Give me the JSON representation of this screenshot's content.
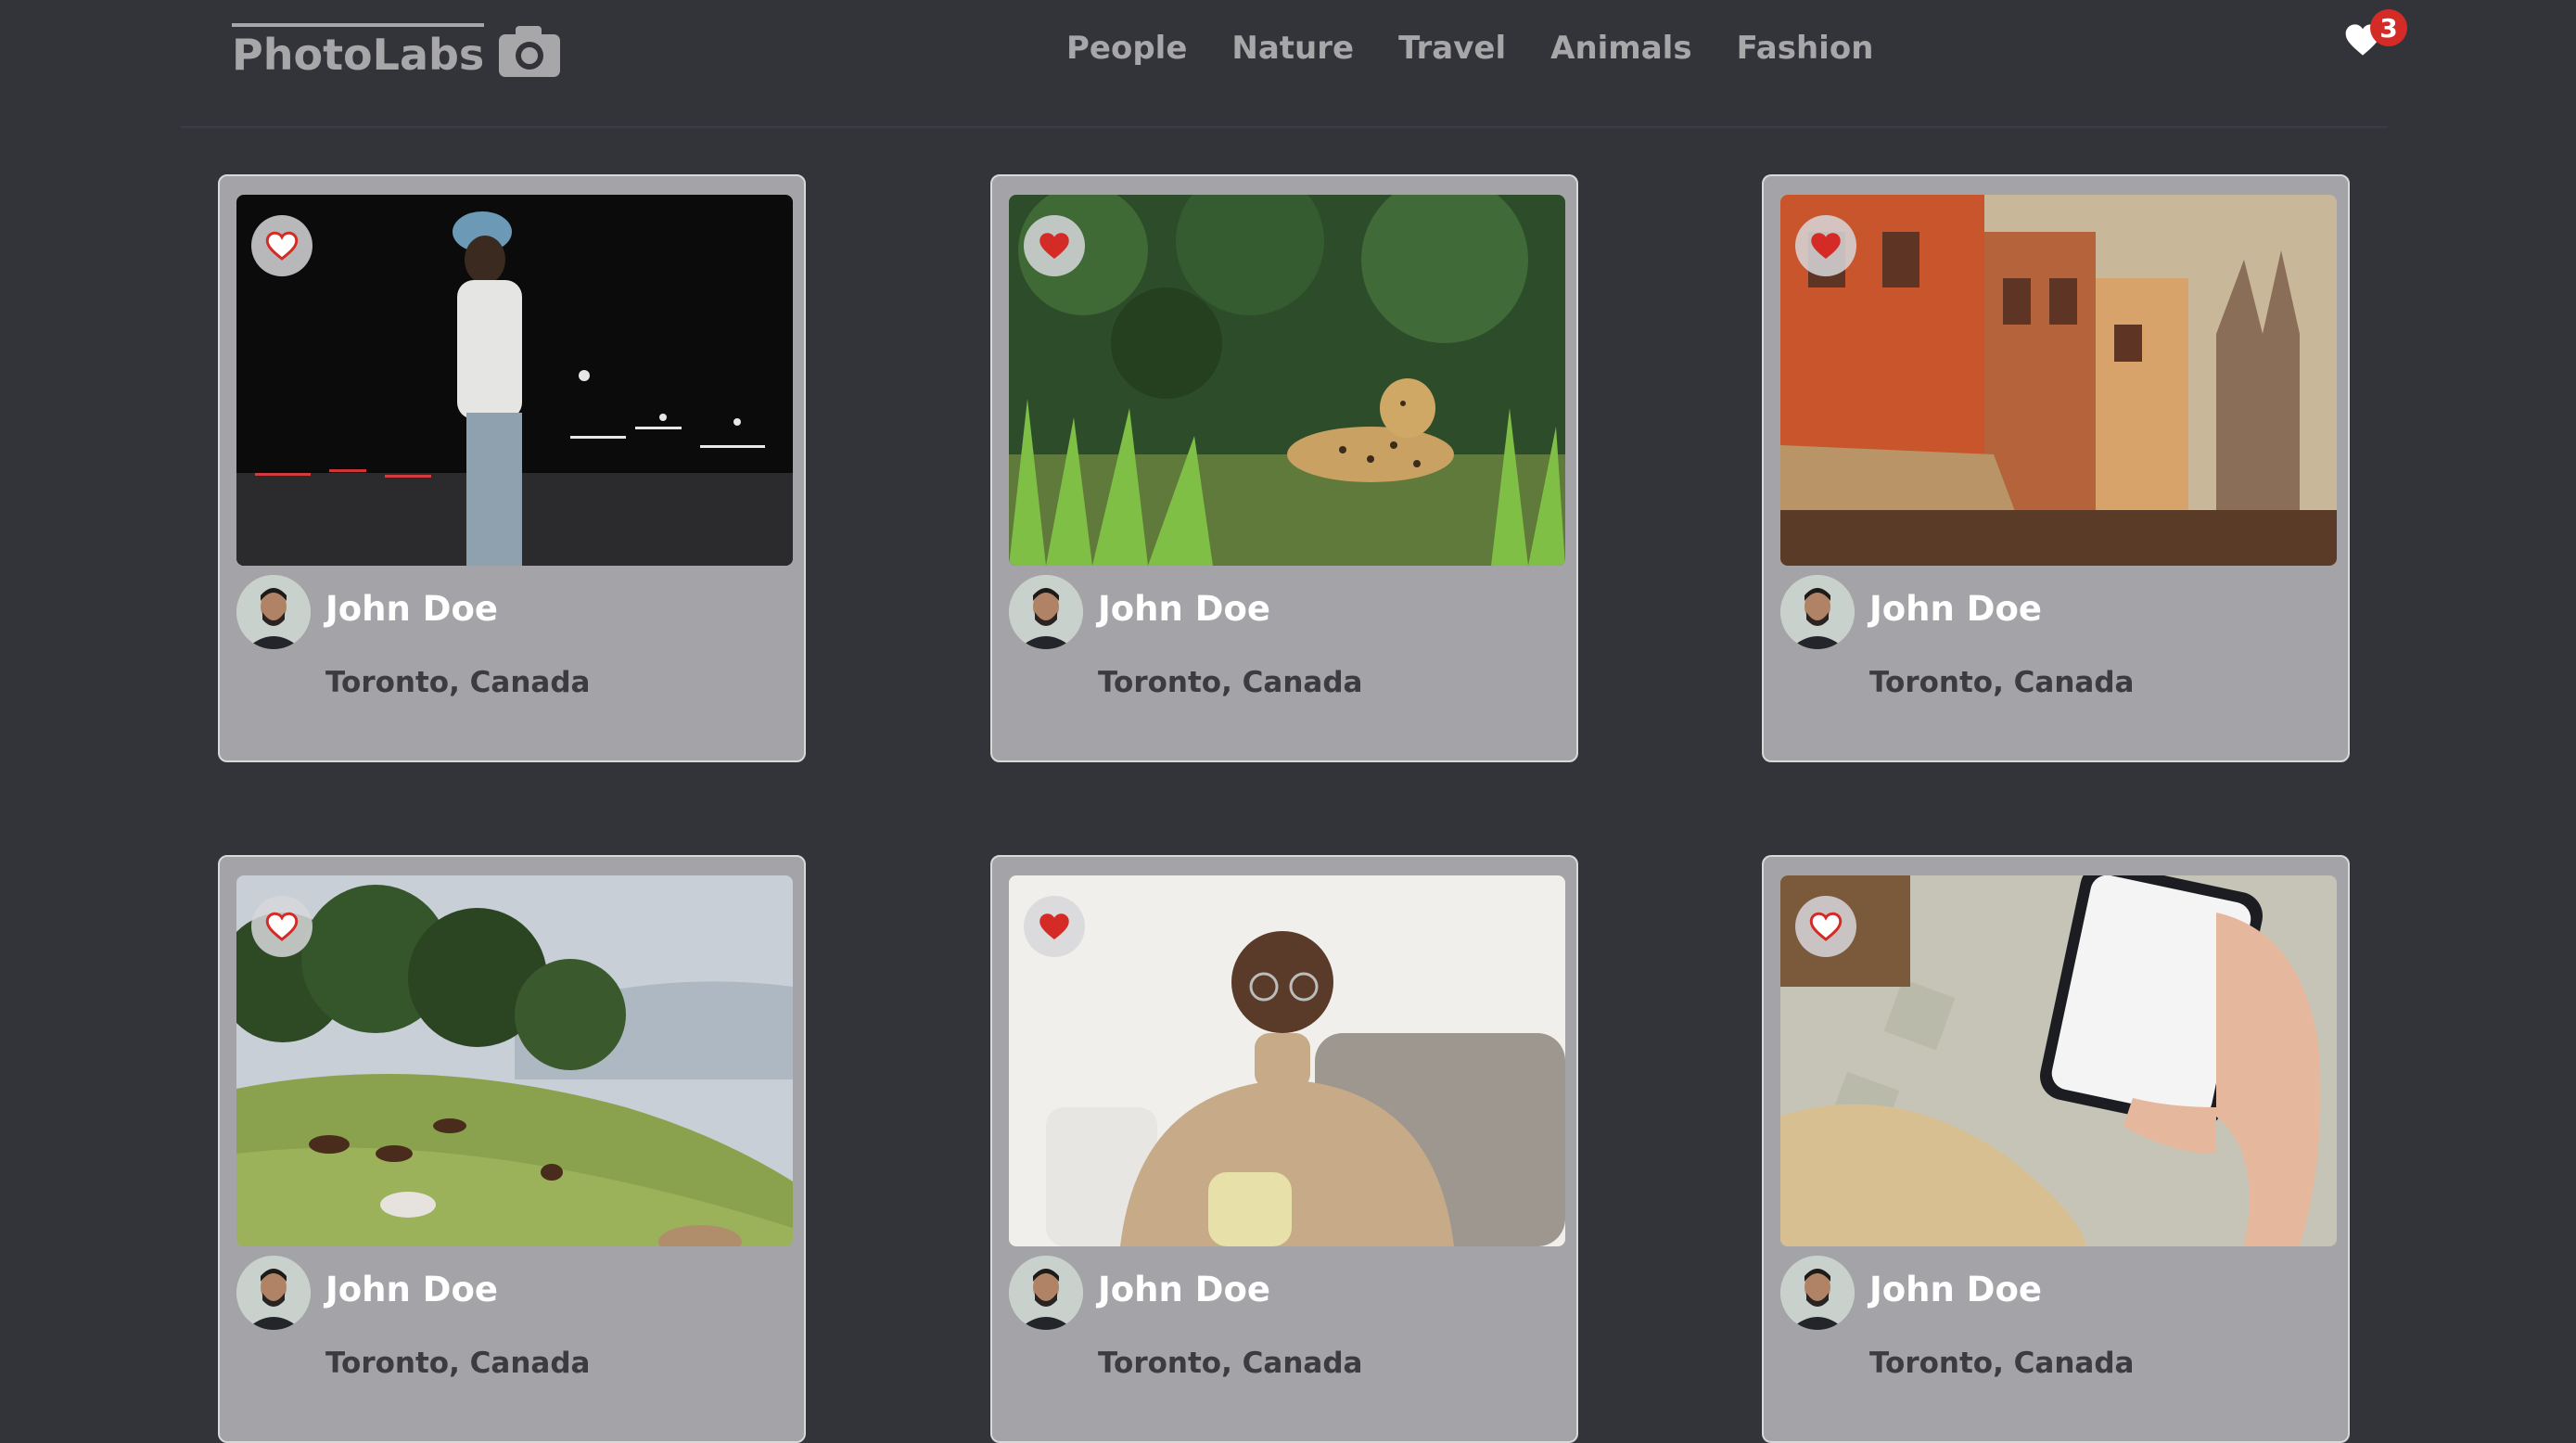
{
  "header": {
    "logo_text": "PhotoLabs",
    "nav": [
      "People",
      "Nature",
      "Travel",
      "Animals",
      "Fashion"
    ],
    "favorites_count": "3"
  },
  "colors": {
    "background": "#33343a",
    "card": "#a4a4a8",
    "heart_red": "#d52b26",
    "nav_text": "#a7a7aa"
  },
  "photos": [
    {
      "user": "John Doe",
      "location": "Toronto, Canada",
      "liked": false,
      "subject": "man in cap walking at night"
    },
    {
      "user": "John Doe",
      "location": "Toronto, Canada",
      "liked": true,
      "subject": "jaguar resting in grass"
    },
    {
      "user": "John Doe",
      "location": "Toronto, Canada",
      "liked": true,
      "subject": "old colorful buildings by river"
    },
    {
      "user": "John Doe",
      "location": "Toronto, Canada",
      "liked": false,
      "subject": "horses grazing on hillside"
    },
    {
      "user": "John Doe",
      "location": "Toronto, Canada",
      "liked": true,
      "subject": "smiling man holding a cup"
    },
    {
      "user": "John Doe",
      "location": "Toronto, Canada",
      "liked": false,
      "subject": "hand holding phone with payment app"
    }
  ]
}
